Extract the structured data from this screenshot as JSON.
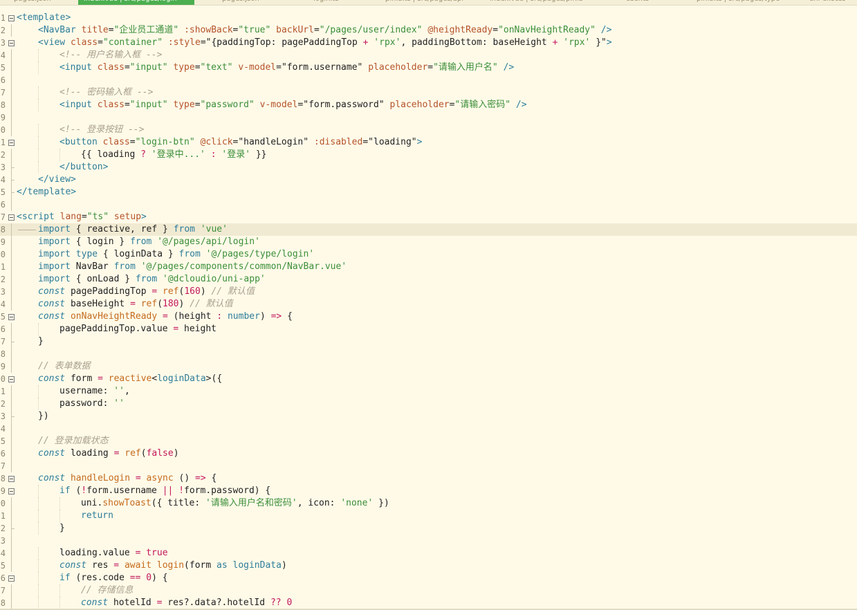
{
  "tabs": [
    {
      "label": "pages.json"
    },
    {
      "label": "index.vue | src/pages/login",
      "active": true
    },
    {
      "label": "pages.json"
    },
    {
      "label": "login.ts"
    },
    {
      "label": "pinia.ts | src/pages/api"
    },
    {
      "label": "index.vue | src/pages/pinia"
    },
    {
      "label": "user.ts"
    },
    {
      "label": "pinia.ts | src/pages/type"
    },
    {
      "label": "uni-ui.scss"
    }
  ],
  "lines": [
    {
      "n": "1",
      "fold": true,
      "indent": 0,
      "t": [
        [
          "tg",
          "<template>"
        ]
      ]
    },
    {
      "n": "2",
      "indent": 1,
      "t": [
        [
          "tg",
          "<NavBar"
        ],
        [
          "pl",
          " "
        ],
        [
          "at",
          "title"
        ],
        [
          "pn",
          "="
        ],
        [
          "st",
          "\"企业员工通道\""
        ],
        [
          "pl",
          " "
        ],
        [
          "at",
          ":showBack"
        ],
        [
          "pn",
          "="
        ],
        [
          "st",
          "\"true\""
        ],
        [
          "pl",
          " "
        ],
        [
          "at",
          "backUrl"
        ],
        [
          "pn",
          "="
        ],
        [
          "st",
          "\"/pages/user/index\""
        ],
        [
          "pl",
          " "
        ],
        [
          "at",
          "@heightReady"
        ],
        [
          "pn",
          "="
        ],
        [
          "st",
          "\"onNavHeightReady\""
        ],
        [
          "pl",
          " "
        ],
        [
          "tg",
          "/>"
        ]
      ]
    },
    {
      "n": "3",
      "fold": true,
      "indent": 1,
      "t": [
        [
          "tg",
          "<view"
        ],
        [
          "pl",
          " "
        ],
        [
          "at",
          "class"
        ],
        [
          "pn",
          "="
        ],
        [
          "st",
          "\"container\""
        ],
        [
          "pl",
          " "
        ],
        [
          "at",
          ":style"
        ],
        [
          "pn",
          "=\"{paddingTop: pagePaddingTop "
        ],
        [
          "op",
          "+"
        ],
        [
          "pn",
          " "
        ],
        [
          "st",
          "'rpx'"
        ],
        [
          "pn",
          ", paddingBottom: baseHeight "
        ],
        [
          "op",
          "+"
        ],
        [
          "pn",
          " "
        ],
        [
          "st",
          "'rpx'"
        ],
        [
          "pn",
          " }\""
        ],
        [
          "tg",
          ">"
        ]
      ]
    },
    {
      "n": "4",
      "indent": 2,
      "t": [
        [
          "cm",
          "<!-- 用户名输入框 -->"
        ]
      ]
    },
    {
      "n": "5",
      "indent": 2,
      "t": [
        [
          "tg",
          "<input"
        ],
        [
          "pl",
          " "
        ],
        [
          "at",
          "class"
        ],
        [
          "pn",
          "="
        ],
        [
          "st",
          "\"input\""
        ],
        [
          "pl",
          " "
        ],
        [
          "at",
          "type"
        ],
        [
          "pn",
          "="
        ],
        [
          "st",
          "\"text\""
        ],
        [
          "pl",
          " "
        ],
        [
          "at",
          "v-model"
        ],
        [
          "pn",
          "="
        ],
        [
          "pn",
          "\"form.username\""
        ],
        [
          "pl",
          " "
        ],
        [
          "at",
          "placeholder"
        ],
        [
          "pn",
          "="
        ],
        [
          "st",
          "\"请输入用户名\""
        ],
        [
          "pl",
          " "
        ],
        [
          "tg",
          "/>"
        ]
      ]
    },
    {
      "n": "6",
      "indent": 0,
      "t": []
    },
    {
      "n": "7",
      "indent": 2,
      "t": [
        [
          "cm",
          "<!-- 密码输入框 -->"
        ]
      ]
    },
    {
      "n": "8",
      "indent": 2,
      "t": [
        [
          "tg",
          "<input"
        ],
        [
          "pl",
          " "
        ],
        [
          "at",
          "class"
        ],
        [
          "pn",
          "="
        ],
        [
          "st",
          "\"input\""
        ],
        [
          "pl",
          " "
        ],
        [
          "at",
          "type"
        ],
        [
          "pn",
          "="
        ],
        [
          "st",
          "\"password\""
        ],
        [
          "pl",
          " "
        ],
        [
          "at",
          "v-model"
        ],
        [
          "pn",
          "="
        ],
        [
          "pn",
          "\"form.password\""
        ],
        [
          "pl",
          " "
        ],
        [
          "at",
          "placeholder"
        ],
        [
          "pn",
          "="
        ],
        [
          "st",
          "\"请输入密码\""
        ],
        [
          "pl",
          " "
        ],
        [
          "tg",
          "/>"
        ]
      ]
    },
    {
      "n": "9",
      "indent": 0,
      "t": []
    },
    {
      "n": "0",
      "indent": 2,
      "t": [
        [
          "cm",
          "<!-- 登录按钮 -->"
        ]
      ]
    },
    {
      "n": "1",
      "fold": true,
      "indent": 2,
      "t": [
        [
          "tg",
          "<button"
        ],
        [
          "pl",
          " "
        ],
        [
          "at",
          "class"
        ],
        [
          "pn",
          "="
        ],
        [
          "st",
          "\"login-btn\""
        ],
        [
          "pl",
          " "
        ],
        [
          "at",
          "@click"
        ],
        [
          "pn",
          "="
        ],
        [
          "pn",
          "\"handleLogin\""
        ],
        [
          "pl",
          " "
        ],
        [
          "at",
          ":disabled"
        ],
        [
          "pn",
          "="
        ],
        [
          "pn",
          "\"loading\""
        ],
        [
          "tg",
          ">"
        ]
      ]
    },
    {
      "n": "2",
      "indent": 3,
      "t": [
        [
          "pn",
          "{{ loading "
        ],
        [
          "op",
          "?"
        ],
        [
          "pn",
          " "
        ],
        [
          "st",
          "'登录中...'"
        ],
        [
          "pn",
          " "
        ],
        [
          "op",
          ":"
        ],
        [
          "pn",
          " "
        ],
        [
          "st",
          "'登录'"
        ],
        [
          "pn",
          " }}"
        ]
      ]
    },
    {
      "n": "3",
      "indent": 2,
      "guideEnd": true,
      "t": [
        [
          "tg",
          "</button>"
        ]
      ]
    },
    {
      "n": "4",
      "indent": 1,
      "guideEnd": true,
      "t": [
        [
          "tg",
          "</view>"
        ]
      ]
    },
    {
      "n": "5",
      "indent": 0,
      "guideEnd": true,
      "t": [
        [
          "tg",
          "</template>"
        ]
      ]
    },
    {
      "n": "6",
      "indent": 0,
      "t": []
    },
    {
      "n": "7",
      "fold": true,
      "indent": 0,
      "t": [
        [
          "tg",
          "<script"
        ],
        [
          "pl",
          " "
        ],
        [
          "at",
          "lang"
        ],
        [
          "pn",
          "="
        ],
        [
          "st",
          "\"ts\""
        ],
        [
          "pl",
          " "
        ],
        [
          "at",
          "setup"
        ],
        [
          "tg",
          ">"
        ]
      ]
    },
    {
      "n": "8",
      "indent": 1,
      "hl": true,
      "arrow": true,
      "t": [
        [
          "kw",
          "import"
        ],
        [
          "pn",
          " { reactive, ref } "
        ],
        [
          "kw",
          "from"
        ],
        [
          "pn",
          " "
        ],
        [
          "st",
          "'vue'"
        ]
      ]
    },
    {
      "n": "9",
      "indent": 1,
      "t": [
        [
          "kw",
          "import"
        ],
        [
          "pn",
          " { login } "
        ],
        [
          "kw",
          "from"
        ],
        [
          "pn",
          " "
        ],
        [
          "st",
          "'@/pages/api/login'"
        ]
      ]
    },
    {
      "n": "0",
      "indent": 1,
      "t": [
        [
          "kw",
          "import"
        ],
        [
          "pn",
          " "
        ],
        [
          "kw",
          "type"
        ],
        [
          "pn",
          " { loginData } "
        ],
        [
          "kw",
          "from"
        ],
        [
          "pn",
          " "
        ],
        [
          "st",
          "'@/pages/type/login'"
        ]
      ]
    },
    {
      "n": "1",
      "indent": 1,
      "t": [
        [
          "kw",
          "import"
        ],
        [
          "pn",
          " NavBar "
        ],
        [
          "kw",
          "from"
        ],
        [
          "pn",
          " "
        ],
        [
          "st",
          "'@/pages/components/common/NavBar.vue'"
        ]
      ]
    },
    {
      "n": "2",
      "indent": 1,
      "t": [
        [
          "kw",
          "import"
        ],
        [
          "pn",
          " { onLoad } "
        ],
        [
          "kw",
          "from"
        ],
        [
          "pn",
          " "
        ],
        [
          "st",
          "'@dcloudio/uni-app'"
        ]
      ]
    },
    {
      "n": "3",
      "indent": 1,
      "t": [
        [
          "kwi",
          "const"
        ],
        [
          "pn",
          " pagePaddingTop "
        ],
        [
          "op",
          "="
        ],
        [
          "pn",
          " "
        ],
        [
          "fn",
          "ref"
        ],
        [
          "pn",
          "("
        ],
        [
          "nm",
          "160"
        ],
        [
          "pn",
          ") "
        ],
        [
          "cm",
          "// 默认值"
        ]
      ]
    },
    {
      "n": "4",
      "indent": 1,
      "t": [
        [
          "kwi",
          "const"
        ],
        [
          "pn",
          " baseHeight "
        ],
        [
          "op",
          "="
        ],
        [
          "pn",
          " "
        ],
        [
          "fn",
          "ref"
        ],
        [
          "pn",
          "("
        ],
        [
          "nm",
          "180"
        ],
        [
          "pn",
          ") "
        ],
        [
          "cm",
          "// 默认值"
        ]
      ]
    },
    {
      "n": "5",
      "fold": true,
      "indent": 1,
      "t": [
        [
          "kwi",
          "const"
        ],
        [
          "pn",
          " "
        ],
        [
          "fn",
          "onNavHeightReady"
        ],
        [
          "pn",
          " "
        ],
        [
          "op",
          "="
        ],
        [
          "pn",
          " (height "
        ],
        [
          "op",
          ":"
        ],
        [
          "pn",
          " "
        ],
        [
          "ty",
          "number"
        ],
        [
          "pn",
          ") "
        ],
        [
          "op",
          "=>"
        ],
        [
          "pn",
          " {"
        ]
      ]
    },
    {
      "n": "6",
      "indent": 2,
      "t": [
        [
          "pn",
          "pagePaddingTop.value "
        ],
        [
          "op",
          "="
        ],
        [
          "pn",
          " height"
        ]
      ]
    },
    {
      "n": "7",
      "indent": 1,
      "guideEnd": true,
      "t": [
        [
          "pn",
          "}"
        ]
      ]
    },
    {
      "n": "8",
      "indent": 0,
      "t": []
    },
    {
      "n": "9",
      "indent": 1,
      "t": [
        [
          "cm",
          "// 表单数据"
        ]
      ]
    },
    {
      "n": "0",
      "fold": true,
      "indent": 1,
      "t": [
        [
          "kwi",
          "const"
        ],
        [
          "pn",
          " form "
        ],
        [
          "op",
          "="
        ],
        [
          "pn",
          " "
        ],
        [
          "fn",
          "reactive"
        ],
        [
          "pn",
          "<"
        ],
        [
          "ty",
          "loginData"
        ],
        [
          "pn",
          ">({"
        ]
      ]
    },
    {
      "n": "1",
      "indent": 2,
      "t": [
        [
          "pn",
          "username: "
        ],
        [
          "st",
          "''"
        ],
        [
          "pn",
          ","
        ]
      ]
    },
    {
      "n": "2",
      "indent": 2,
      "t": [
        [
          "pn",
          "password: "
        ],
        [
          "st",
          "''"
        ]
      ]
    },
    {
      "n": "3",
      "indent": 1,
      "guideEnd": true,
      "t": [
        [
          "pn",
          "})"
        ]
      ]
    },
    {
      "n": "4",
      "indent": 0,
      "t": []
    },
    {
      "n": "5",
      "indent": 1,
      "t": [
        [
          "cm",
          "// 登录加载状态"
        ]
      ]
    },
    {
      "n": "6",
      "indent": 1,
      "t": [
        [
          "kwi",
          "const"
        ],
        [
          "pn",
          " loading "
        ],
        [
          "op",
          "="
        ],
        [
          "pn",
          " "
        ],
        [
          "fn",
          "ref"
        ],
        [
          "pn",
          "("
        ],
        [
          "bl",
          "false"
        ],
        [
          "pn",
          ")"
        ]
      ]
    },
    {
      "n": "7",
      "indent": 0,
      "t": []
    },
    {
      "n": "8",
      "fold": true,
      "indent": 1,
      "t": [
        [
          "kwi",
          "const"
        ],
        [
          "pn",
          " "
        ],
        [
          "fn",
          "handleLogin"
        ],
        [
          "pn",
          " "
        ],
        [
          "op",
          "="
        ],
        [
          "pn",
          " "
        ],
        [
          "fn",
          "async"
        ],
        [
          "pn",
          " () "
        ],
        [
          "op",
          "=>"
        ],
        [
          "pn",
          " {"
        ]
      ]
    },
    {
      "n": "9",
      "fold": true,
      "indent": 2,
      "t": [
        [
          "kw",
          "if"
        ],
        [
          "pn",
          " ("
        ],
        [
          "op",
          "!"
        ],
        [
          "pn",
          "form.username "
        ],
        [
          "op",
          "||"
        ],
        [
          "pn",
          " "
        ],
        [
          "op",
          "!"
        ],
        [
          "pn",
          "form.password) {"
        ]
      ]
    },
    {
      "n": "0",
      "indent": 3,
      "t": [
        [
          "pn",
          "uni."
        ],
        [
          "fn",
          "showToast"
        ],
        [
          "pn",
          "({ title: "
        ],
        [
          "st",
          "'请输入用户名和密码'"
        ],
        [
          "pn",
          ", icon: "
        ],
        [
          "st",
          "'none'"
        ],
        [
          "pn",
          " })"
        ]
      ]
    },
    {
      "n": "1",
      "indent": 3,
      "t": [
        [
          "kw",
          "return"
        ]
      ]
    },
    {
      "n": "2",
      "indent": 2,
      "guideEnd": true,
      "t": [
        [
          "pn",
          "}"
        ]
      ]
    },
    {
      "n": "3",
      "indent": 0,
      "t": []
    },
    {
      "n": "4",
      "indent": 2,
      "t": [
        [
          "pn",
          "loading.value "
        ],
        [
          "op",
          "="
        ],
        [
          "pn",
          " "
        ],
        [
          "bl",
          "true"
        ]
      ]
    },
    {
      "n": "5",
      "indent": 2,
      "t": [
        [
          "kwi",
          "const"
        ],
        [
          "pn",
          " res "
        ],
        [
          "op",
          "="
        ],
        [
          "pn",
          " "
        ],
        [
          "fn",
          "await"
        ],
        [
          "pn",
          " "
        ],
        [
          "fn",
          "login"
        ],
        [
          "pn",
          "(form "
        ],
        [
          "kw",
          "as"
        ],
        [
          "pn",
          " "
        ],
        [
          "ty",
          "loginData"
        ],
        [
          "pn",
          ")"
        ]
      ]
    },
    {
      "n": "6",
      "fold": true,
      "indent": 2,
      "t": [
        [
          "kw",
          "if"
        ],
        [
          "pn",
          " (res.code "
        ],
        [
          "op",
          "=="
        ],
        [
          "pn",
          " "
        ],
        [
          "nm",
          "0"
        ],
        [
          "pn",
          ") {"
        ]
      ]
    },
    {
      "n": "7",
      "indent": 3,
      "t": [
        [
          "cm",
          "// 存储信息"
        ]
      ]
    },
    {
      "n": "8",
      "indent": 3,
      "t": [
        [
          "kwi",
          "const"
        ],
        [
          "pn",
          " hotelId "
        ],
        [
          "op",
          "="
        ],
        [
          "pn",
          " res?.data?.hotelId "
        ],
        [
          "op",
          "??"
        ],
        [
          "pn",
          " "
        ],
        [
          "nm",
          "0"
        ]
      ]
    }
  ]
}
